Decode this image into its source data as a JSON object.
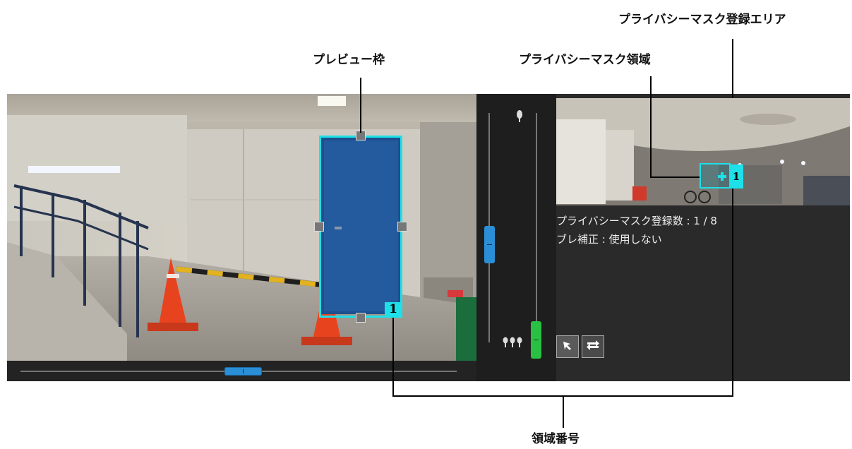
{
  "callouts": {
    "preview_frame": "プレビュー枠",
    "mask_region": "プライバシーマスク領域",
    "mask_registration_area": "プライバシーマスク登録エリア",
    "region_number": "領域番号"
  },
  "mask_info": {
    "registered_count": "プライバシーマスク登録数 : 1 / 8",
    "stabilization": "ブレ補正 : 使用しない"
  },
  "preview_frame": {
    "region_number": "1"
  },
  "mask_area": {
    "region_number": "1"
  },
  "controls": {
    "select_tool_icon": "cursor-arrow-icon",
    "swap_tool_icon": "swap-arrows-icon",
    "zoom_wide_icon": "tree-single-icon",
    "zoom_tele_icon": "tree-cluster-icon"
  },
  "colors": {
    "frame_accent": "#1ee0e8",
    "slider_blue": "#2a8fd6",
    "zoom_green": "#2ac043"
  }
}
